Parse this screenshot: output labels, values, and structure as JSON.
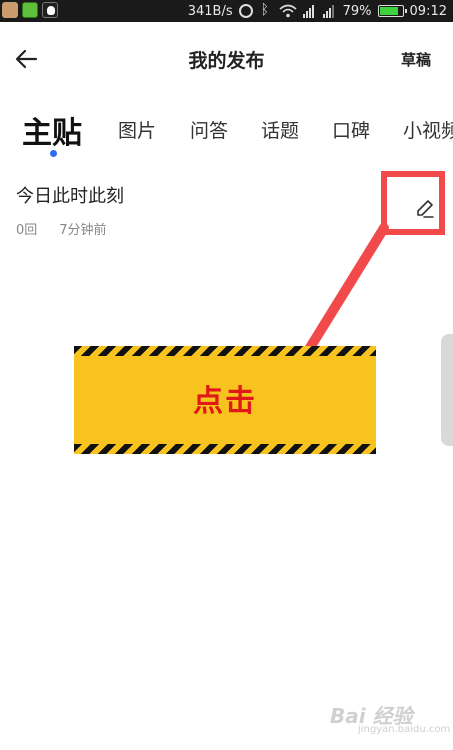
{
  "status_bar": {
    "network_speed": "341B/s",
    "battery": "79%",
    "time": "09:12",
    "battery_fraction": 0.79
  },
  "header": {
    "title": "我的发布",
    "drafts_label": "草稿",
    "back_icon": "arrow-left-icon"
  },
  "tabs": [
    {
      "label": "主贴",
      "active": true
    },
    {
      "label": "图片"
    },
    {
      "label": "问答"
    },
    {
      "label": "话题"
    },
    {
      "label": "口碑"
    },
    {
      "label": "小视频"
    }
  ],
  "post": {
    "title": "今日此时此刻",
    "replies": "0回",
    "time_ago": "7分钟前",
    "edit_icon": "pencil-icon"
  },
  "annotation": {
    "banner_text": "点击",
    "highlight_color": "#f24a4a",
    "banner_color": "#f8c31e",
    "text_color": "#e01818"
  },
  "watermark": {
    "text": "Bai 经验",
    "sub": "jingyan.baidu.com"
  },
  "colors": {
    "accent": "#2e6bf2"
  }
}
